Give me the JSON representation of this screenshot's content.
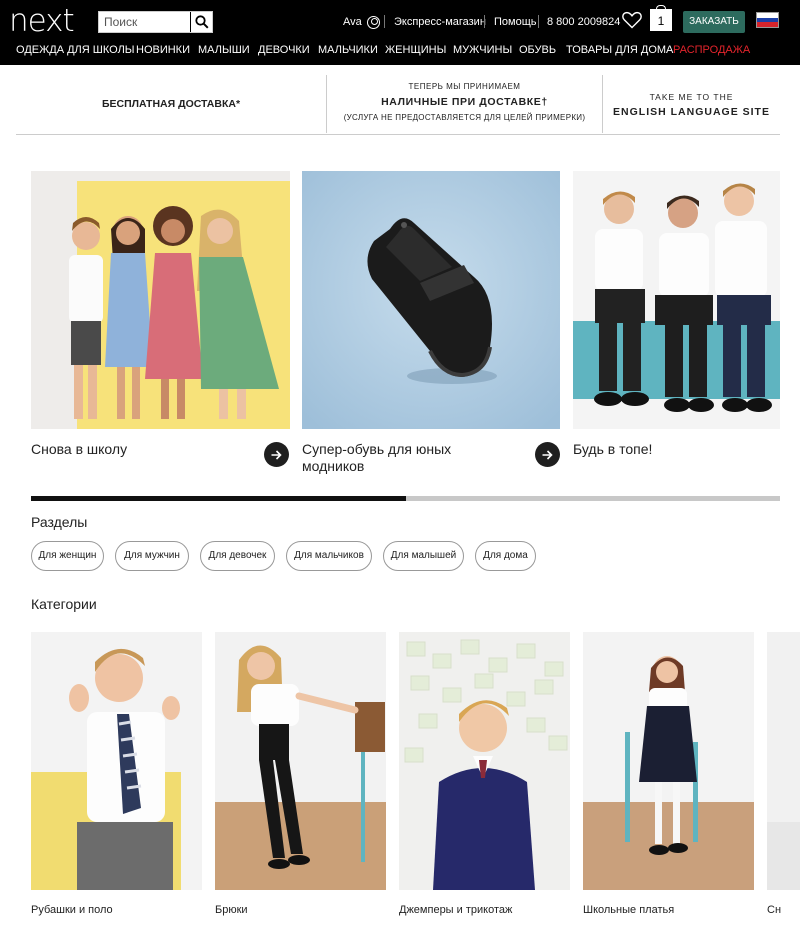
{
  "header": {
    "logo": "next",
    "search_placeholder": "Поиск",
    "user_name": "Ava",
    "express_store": "Экспресс-магазин",
    "help": "Помощь",
    "phone": "8 800 2009824",
    "bag_count": "1",
    "order_button": "ЗАКАЗАТЬ",
    "accent_color": "#2d6b5e",
    "sale_color": "#e4242c"
  },
  "nav": {
    "items": [
      "ОДЕЖДА ДЛЯ ШКОЛЫ",
      "НОВИНКИ",
      "МАЛЫШИ",
      "ДЕВОЧКИ",
      "МАЛЬЧИКИ",
      "ЖЕНЩИНЫ",
      "МУЖЧИНЫ",
      "ОБУВЬ",
      "ТОВАРЫ ДЛЯ ДОМА",
      "РАСПРОДАЖА"
    ]
  },
  "promo": {
    "free_delivery": "БЕСПЛАТНАЯ ДОСТАВКА*",
    "cash_line1": "ТЕПЕРЬ МЫ ПРИНИМАЕМ",
    "cash_line2": "НАЛИЧНЫЕ ПРИ ДОСТАВКЕ†",
    "cash_line3": "(УСЛУГА НЕ ПРЕДОСТАВЛЯЕТСЯ ДЛЯ ЦЕЛЕЙ ПРИМЕРКИ)",
    "english_line1": "TAKE ME TO THE",
    "english_line2": "ENGLISH LANGUAGE SITE"
  },
  "hero": {
    "cards": [
      {
        "label": "Снова в школу"
      },
      {
        "label": "Супер-обувь для юных модников"
      },
      {
        "label": "Будь в топе!"
      }
    ],
    "carousel_progress": 0.5
  },
  "sections": {
    "title": "Разделы",
    "pills": [
      "Для женщин",
      "Для мужчин",
      "Для девочек",
      "Для мальчиков",
      "Для малышей",
      "Для дома"
    ]
  },
  "categories": {
    "title": "Категории",
    "items": [
      {
        "label": "Рубашки и поло"
      },
      {
        "label": "Брюки"
      },
      {
        "label": "Джемперы и трикотаж"
      },
      {
        "label": "Школьные платья"
      },
      {
        "label": "Сн"
      }
    ]
  }
}
